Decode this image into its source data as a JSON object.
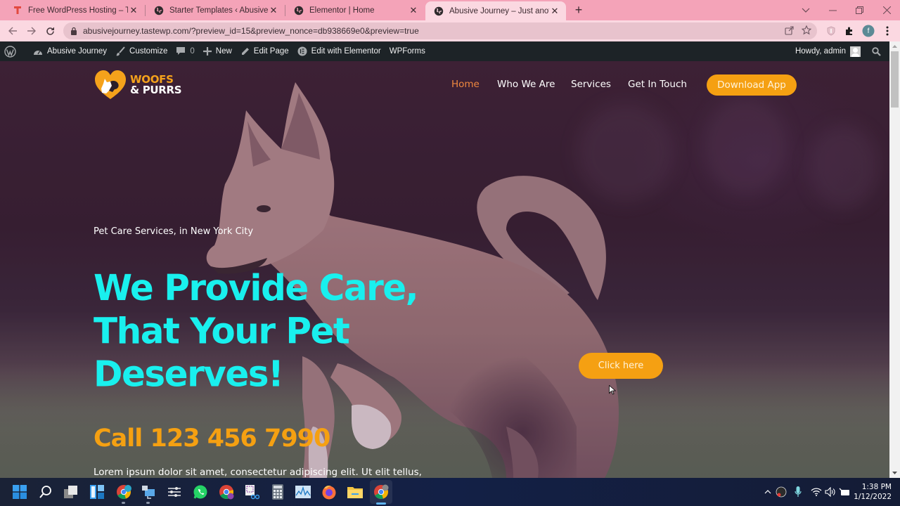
{
  "browser": {
    "tabs": [
      {
        "title": "Free WordPress Hosting – TasteWP",
        "favicon": "tastewp-icon",
        "active": false
      },
      {
        "title": "Starter Templates ‹ Abusive Journey",
        "favicon": "globe-icon",
        "active": false
      },
      {
        "title": "Elementor | Home",
        "favicon": "globe-icon",
        "active": false
      },
      {
        "title": "Abusive Journey – Just another WordPress site",
        "favicon": "globe-icon",
        "active": true
      }
    ],
    "new_tab_label": "+",
    "url": "abusivejourney.tastewp.com/?preview_id=15&preview_nonce=db938669e0&preview=true",
    "profile_initial": "f"
  },
  "adminbar": {
    "site_name": "Abusive Journey",
    "customize": "Customize",
    "comments_count": "0",
    "new": "New",
    "edit_page": "Edit Page",
    "edit_elementor": "Edit with Elementor",
    "wpforms": "WPForms",
    "howdy": "Howdy, admin"
  },
  "site": {
    "logo": {
      "line1": "WOOFS",
      "line2": "& PURRS"
    },
    "nav": [
      {
        "label": "Home",
        "active": true
      },
      {
        "label": "Who We Are",
        "active": false
      },
      {
        "label": "Services",
        "active": false
      },
      {
        "label": "Get In Touch",
        "active": false
      }
    ],
    "download_button": "Download App",
    "hero": {
      "tagline": "Pet Care Services, in New York City",
      "headline_lines": [
        "We Provide Care,",
        "That Your Pet",
        "Deserves!"
      ],
      "call": "Call 123 456 7990",
      "body": "Lorem ipsum dolor sit amet, consectetur adipiscing elit. Ut elit tellus,",
      "cta": "Click here"
    },
    "colors": {
      "accent_orange": "#f5a012",
      "headline_cyan": "#19f0ee",
      "nav_active": "#f0883f"
    }
  },
  "taskbar": {
    "apps": [
      "start",
      "search",
      "task-view",
      "widgets",
      "chrome-profile",
      "network-app",
      "settings-sliders",
      "whatsapp",
      "chrome-alt",
      "snipping-tool",
      "calculator",
      "resource-monitor",
      "firefox",
      "file-explorer",
      "chrome-active"
    ],
    "time": "1:38 PM",
    "date": "1/12/2022"
  }
}
